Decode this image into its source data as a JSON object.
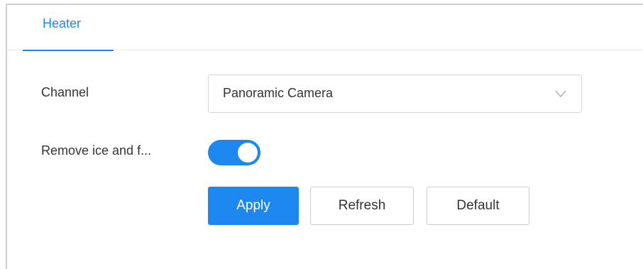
{
  "tabs": [
    {
      "label": "Heater",
      "active": true
    }
  ],
  "form": {
    "channel": {
      "label": "Channel",
      "value": "Panoramic Camera",
      "icon": "chevron-down-icon"
    },
    "remove_ice": {
      "label": "Remove ice and f...",
      "enabled": true
    }
  },
  "buttons": {
    "apply": "Apply",
    "refresh": "Refresh",
    "default": "Default"
  },
  "colors": {
    "accent": "#1d87f0",
    "text": "#333333",
    "border": "#d8d8d8"
  }
}
